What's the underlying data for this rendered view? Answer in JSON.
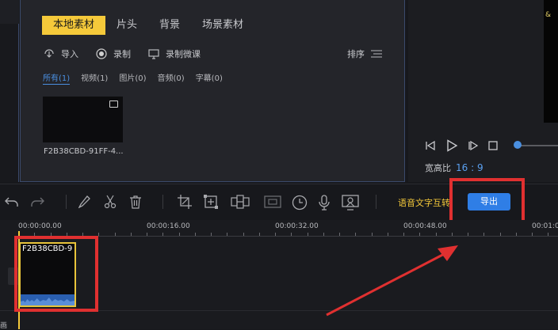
{
  "media_library": {
    "tabs": [
      {
        "label": "本地素材",
        "active": true
      },
      {
        "label": "片头",
        "active": false
      },
      {
        "label": "背景",
        "active": false
      },
      {
        "label": "场景素材",
        "active": false
      }
    ],
    "tools": {
      "import_label": "导入",
      "record_label": "录制",
      "record_lesson_label": "录制微课"
    },
    "sort_label": "排序",
    "filters": [
      {
        "label": "所有(1)",
        "active": true
      },
      {
        "label": "视频(1)",
        "active": false
      },
      {
        "label": "图片(0)",
        "active": false
      },
      {
        "label": "音频(0)",
        "active": false
      },
      {
        "label": "字幕(0)",
        "active": false
      }
    ],
    "item": {
      "name": "F2B38CBD-91FF-4..."
    }
  },
  "preview": {
    "aspect_label": "宽高比",
    "aspect_value": "16 : 9",
    "corner_glyph": "&"
  },
  "toolbar": {
    "voice_text_label": "语音文字互转",
    "export_label": "导出"
  },
  "timeline": {
    "ticks": [
      "00:00:00.00",
      "00:00:16.00",
      "00:00:32.00",
      "00:00:48.00",
      "00:01:0"
    ],
    "clip_name": "F2B38CBD-9",
    "bottom_label": "画"
  },
  "annotations": {
    "highlight_color": "#e03030"
  },
  "colors": {
    "accent_yellow": "#f5c93a",
    "accent_blue": "#2f7ee6"
  }
}
